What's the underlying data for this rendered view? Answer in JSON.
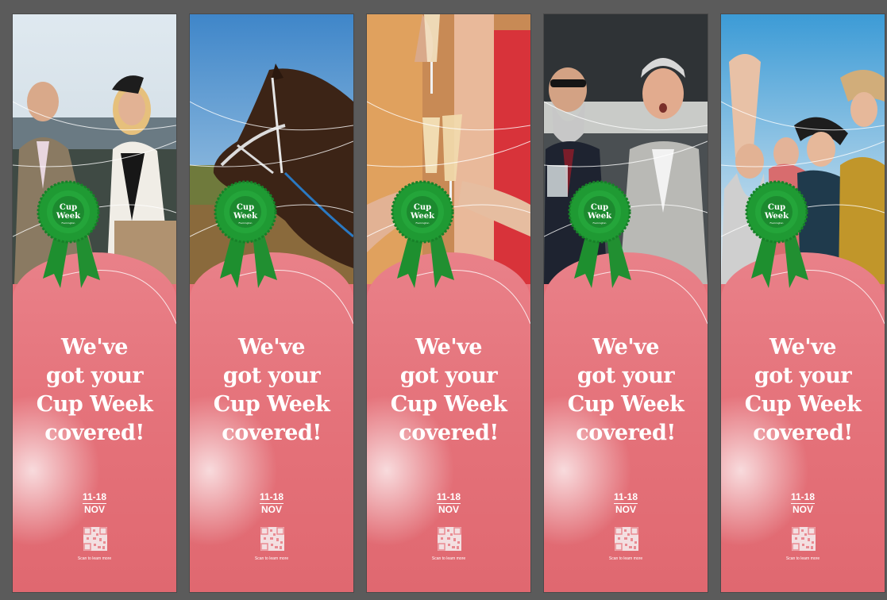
{
  "campaign": {
    "headline_lines": [
      "We've",
      "got your",
      "Cup Week",
      "covered!"
    ],
    "date_range": "11-18",
    "month": "NOV",
    "qr_caption": "Scan to learn more",
    "rosette_line1": "Cup",
    "rosette_line2": "Week",
    "rosette_tagline": "Flemington"
  },
  "banners": [
    {
      "scene": "racegoers-couple"
    },
    {
      "scene": "racehorse"
    },
    {
      "scene": "champagne-toast"
    },
    {
      "scene": "men-cheering"
    },
    {
      "scene": "women-selfie"
    }
  ],
  "colors": {
    "background": "#5b5b5b",
    "banner_pink": "#e7727a",
    "rosette_green": "#1f9a33",
    "text": "#ffffff"
  }
}
